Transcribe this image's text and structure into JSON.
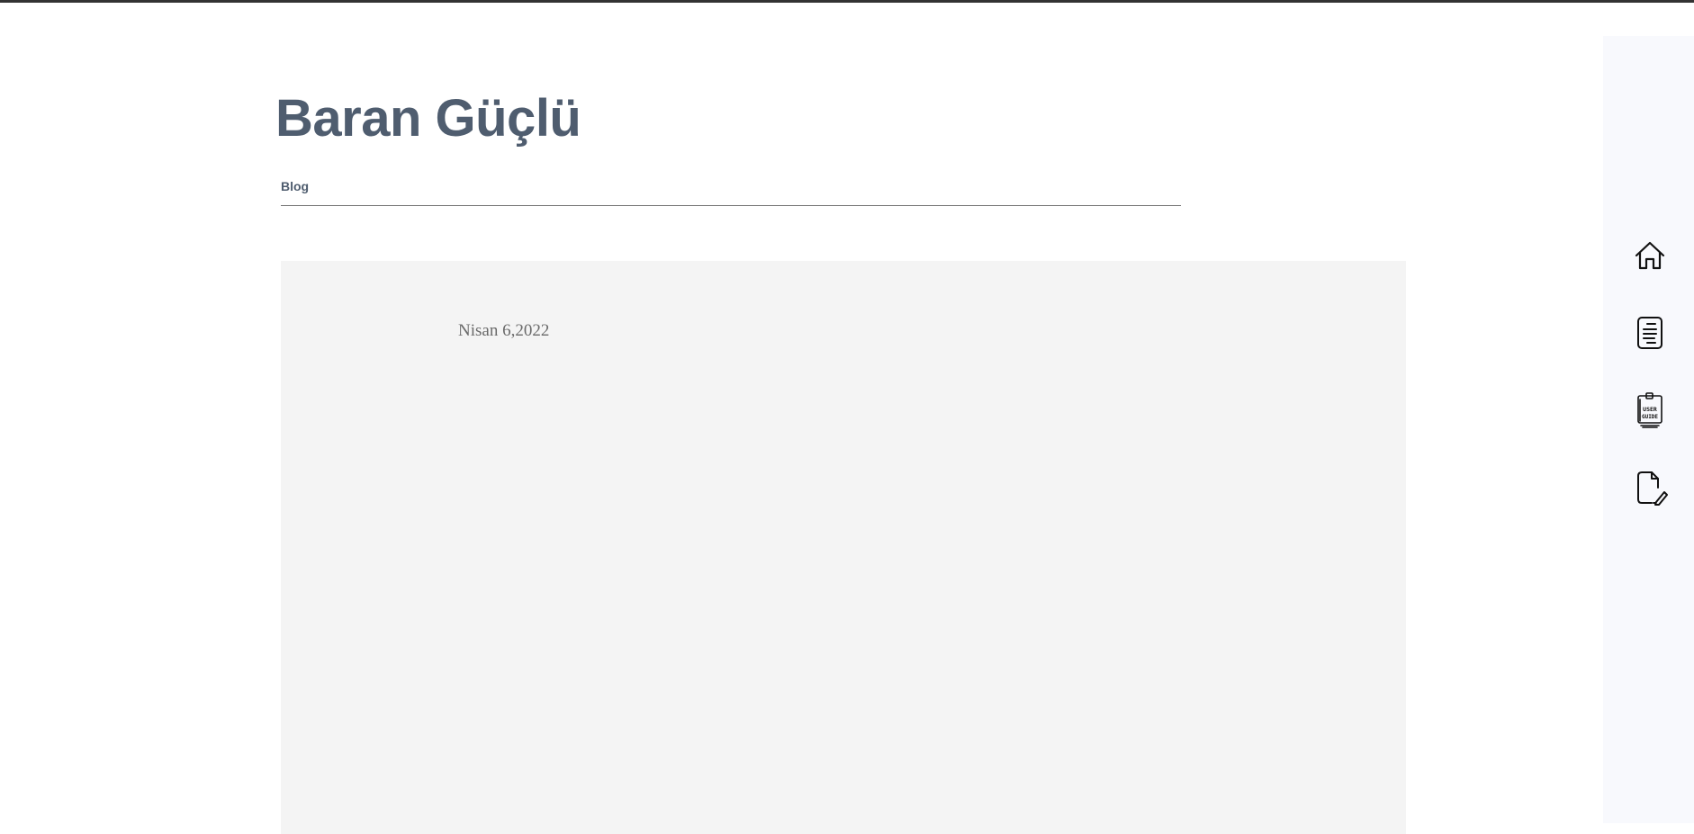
{
  "site": {
    "title": "Baran Güçlü"
  },
  "nav": {
    "items": [
      {
        "label": "Blog"
      }
    ]
  },
  "post": {
    "date": "Nisan 6,2022"
  },
  "sidebar": {
    "icons": [
      {
        "name": "home-icon"
      },
      {
        "name": "document-icon"
      },
      {
        "name": "user-guide-icon",
        "label": "USER GUIDE"
      },
      {
        "name": "edit-document-icon"
      }
    ]
  },
  "colors": {
    "title": "#4f5d6f",
    "content_bg": "#f4f4f4",
    "sidebar_bg": "#f8f9fd",
    "top_bar": "#333333"
  }
}
